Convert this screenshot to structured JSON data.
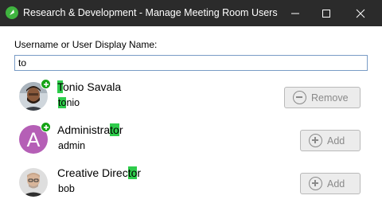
{
  "window": {
    "title": "Research & Development - Manage Meeting Room Users",
    "controls": [
      "minimize",
      "maximize",
      "close"
    ]
  },
  "search": {
    "label": "Username or User Display Name:",
    "value": "to"
  },
  "users": [
    {
      "display_name_pre": "",
      "display_name_match": "T",
      "display_name_post": "onio Savala",
      "username_pre": "",
      "username_match": "to",
      "username_post": "nio",
      "has_badge": true,
      "action_label": "Remove",
      "action_icon": "minus-circle-icon"
    },
    {
      "display_name_pre": "Administra",
      "display_name_match": "to",
      "display_name_post": "r",
      "username_pre": "admin",
      "username_match": "",
      "username_post": "",
      "avatar_letter": "A",
      "avatar_color": "#b55fb6",
      "has_badge": true,
      "action_label": "Add",
      "action_icon": "plus-circle-icon"
    },
    {
      "display_name_pre": "Creative Direc",
      "display_name_match": "to",
      "display_name_post": "r",
      "username_pre": "bob",
      "username_match": "",
      "username_post": "",
      "has_badge": false,
      "action_label": "Add",
      "action_icon": "plus-circle-icon"
    }
  ],
  "colors": {
    "titlebar": "#2b2b2b",
    "highlight": "#2ecc4b",
    "badge": "#16a316",
    "button_bg": "#ececec",
    "button_text": "#8a8a8a"
  }
}
